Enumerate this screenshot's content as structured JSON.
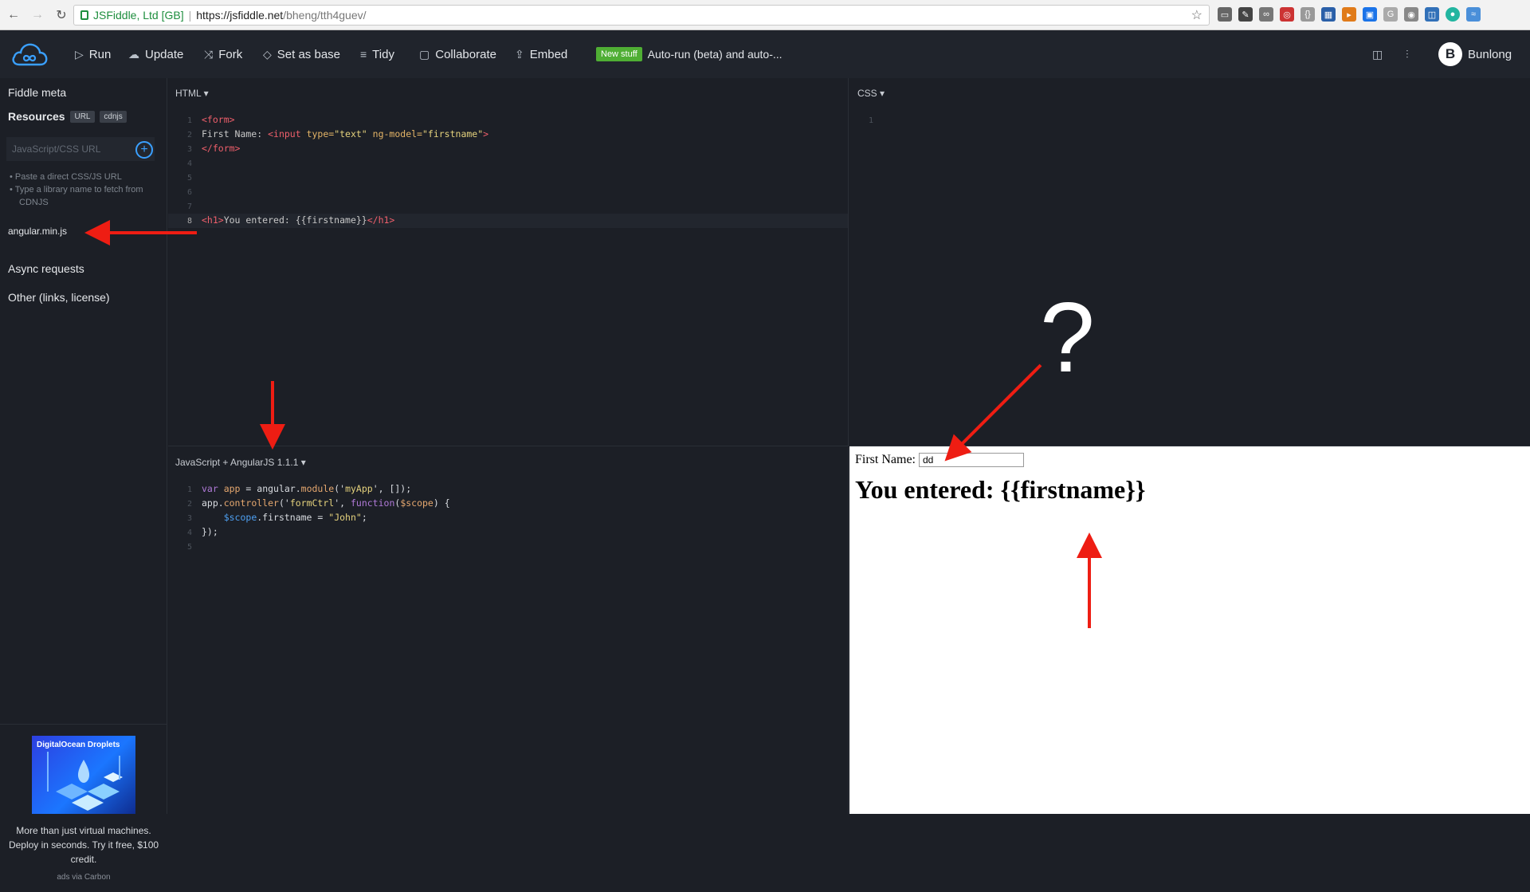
{
  "browser": {
    "site_name": "JSFiddle, Ltd [GB]",
    "url_host": "https://jsfiddle.net",
    "url_path": "/bheng/tth4guev/"
  },
  "toolbar": {
    "run": "Run",
    "update": "Update",
    "fork": "Fork",
    "set_as_base": "Set as base",
    "tidy": "Tidy",
    "collaborate": "Collaborate",
    "embed": "Embed",
    "new_badge": "New stuff",
    "news": "Auto-run (beta) and auto-...",
    "user": "Bunlong",
    "user_initial": "B"
  },
  "sidebar": {
    "fiddle_meta": "Fiddle meta",
    "resources": "Resources",
    "tag_url": "URL",
    "tag_cdnjs": "cdnjs",
    "input_placeholder": "JavaScript/CSS URL",
    "hint1": "Paste a direct CSS/JS URL",
    "hint2": "Type a library name to fetch from CDNJS",
    "resource_file": "angular.min.js",
    "async": "Async requests",
    "other": "Other (links, license)"
  },
  "ad": {
    "brand": "DigitalOcean Droplets",
    "text": "More than just virtual machines. Deploy in seconds. Try it free, $100 credit.",
    "source": "ads via Carbon"
  },
  "panels": {
    "html_title": "HTML",
    "css_title": "CSS",
    "js_title": "JavaScript + AngularJS 1.1.1"
  },
  "html_code": {
    "l1": "<form>",
    "l2_pre": "First Name: ",
    "l2_tag": "<input ",
    "l2_attr1": "type=",
    "l2_val1": "\"text\"",
    "l2_attr2": " ng-model=",
    "l2_val2": "\"firstname\"",
    "l2_end": ">",
    "l3": "</form>",
    "l8_open": "<h1>",
    "l8_text": "You entered: {{firstname}}",
    "l8_close": "</h1>"
  },
  "js_code": {
    "l1_var": "var ",
    "l1_name": "app",
    "l1_eq": " = ",
    "l1_obj": "angular.",
    "l1_fn": "module",
    "l1_args": "('",
    "l1_str": "myApp",
    "l1_rest": "', []);",
    "l2_obj": "app.",
    "l2_fn": "controller",
    "l2_a": "('",
    "l2_str": "formCtrl",
    "l2_b": "', ",
    "l2_kw": "function",
    "l2_c": "(",
    "l2_param": "$scope",
    "l2_d": ") {",
    "l3_scope": "$scope",
    "l3_prop": ".firstname = ",
    "l3_str": "\"John\"",
    "l3_end": ";",
    "l4": "});"
  },
  "line_numbers": {
    "html": [
      "1",
      "2",
      "3",
      "4",
      "5",
      "6",
      "7",
      "8"
    ],
    "css": [
      "1"
    ],
    "js": [
      "1",
      "2",
      "3",
      "4",
      "5"
    ]
  },
  "result": {
    "label": "First Name:",
    "input_value": "dd",
    "heading": "You entered: {{firstname}}"
  },
  "annotation": {
    "question_mark": "?"
  },
  "colors": {
    "bg": "#1c1f26",
    "topbar": "#20242c",
    "accent": "#3aa0ff",
    "badge": "#4fae34",
    "arrow": "#ee1d13"
  }
}
